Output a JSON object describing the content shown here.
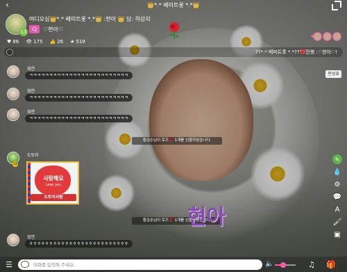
{
  "topbar": {
    "title": "👑*.* 베미트롯 *.*👑",
    "back_glyph": "‹"
  },
  "room": {
    "title": "여디모심👑*.* 베미트롯 *.*👑 :현아 👑 담: 하강지",
    "badge": "CJ",
    "host_name": "♡현아♡",
    "host_level": "13",
    "stats": [
      {
        "icon": "♥",
        "value": "86"
      },
      {
        "icon": "👁",
        "value": "175"
      },
      {
        "icon": "👍",
        "value": "26"
      },
      {
        "icon": "★",
        "value": "519"
      }
    ]
  },
  "notice": {
    "text": "??*.* 베미트롯 *.*??🎀진행 :♡현아♡!"
  },
  "edit_chip": "편성표",
  "chat": [
    {
      "name": "희연",
      "message": "ㅋㅋㅋㅋㅋㅋㅋㅋㅋㅋㅋㅋㅋㅋㅋㅋㅋㅋㅋㅋㅋㅋㅋㅋㅋ"
    },
    {
      "name": "희연",
      "message": "ㅋㅋㅋㅋㅋㅋㅋㅋㅋㅋㅋㅋㅋㅋㅋㅋㅋㅋㅋㅋㅋㅋㅋㅋㅋ"
    },
    {
      "name": "희연",
      "message": "ㅋㅋㅋㅋㅋㅋㅋㅋㅋㅋㅋㅋㅋㅋㅋㅋㅋㅋㅋㅋㅋㅋㅋㅋㅋ"
    },
    {
      "name": "도토리",
      "level": "18",
      "sticker_top": "사랑해요",
      "sticker_sub": "Love you",
      "sticker_bottom": "도토리사랑"
    },
    {
      "name": "희연",
      "message": "ㅎㅎㅎㅎㅎㅎㅎㅎㅎㅎㅎㅎㅎㅎㅎㅎㅎㅎㅎㅎㅎㅎㅎㅎㅎ"
    }
  ],
  "gift_notices": [
    "황금손님이 로즈🌹 1개를 선물하였습니다.",
    "황금손님이 로즈🌹 1개를 선물하였습니다."
  ],
  "watermark": "현아",
  "input": {
    "placeholder": "대화를 입력해 주세요."
  },
  "volume": 0.4,
  "colors": {
    "accent": "#ff5aa8",
    "badge": "#e45ab0",
    "tool_pen": "#5ab54b",
    "watermark": "#8a46b8"
  },
  "icons": {
    "back": "back-icon",
    "collapse": "collapse-icon",
    "rose": "rose-icon",
    "volume": "speaker-icon",
    "music": "music-note-icon",
    "gift": "gift-icon",
    "menu": "menu-icon",
    "tools": [
      "pencil-icon",
      "drop-icon",
      "gear-icon",
      "chat-icon",
      "text-icon",
      "brush-icon",
      "image-icon"
    ]
  }
}
